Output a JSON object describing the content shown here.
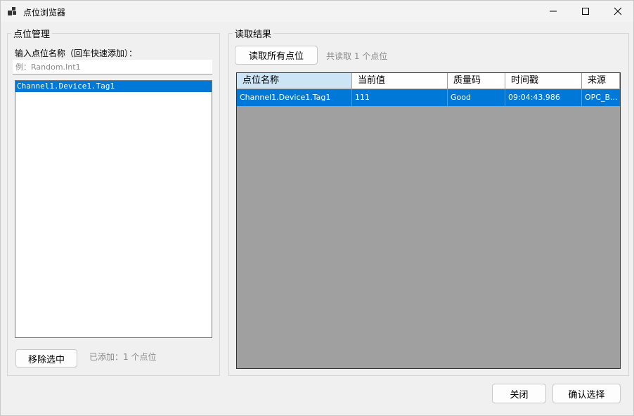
{
  "window": {
    "title": "点位浏览器",
    "icon": "app-window-icon"
  },
  "left_panel": {
    "group_title": "点位管理",
    "input_label": "输入点位名称（回车快速添加）：",
    "input_placeholder": "例：Random.Int1",
    "input_value": "",
    "list_items": [
      "Channel1.Device1.Tag1"
    ],
    "remove_button": "移除选中",
    "added_status": "已添加：1 个点位"
  },
  "right_panel": {
    "group_title": "读取结果",
    "read_all_button": "读取所有点位",
    "read_status": "共读取 1 个点位",
    "columns": [
      "点位名称",
      "当前值",
      "质量码",
      "时间戳",
      "来源"
    ],
    "rows": [
      [
        "Channel1.Device1.Tag1",
        "111",
        "Good",
        "09:04:43.986",
        "OPC_B..."
      ]
    ]
  },
  "footer": {
    "close_button": "关闭",
    "confirm_button": "确认选择"
  },
  "colors": {
    "selection": "#0078d7",
    "header_selected": "#cce5f6",
    "grid_background": "#a0a0a0"
  }
}
